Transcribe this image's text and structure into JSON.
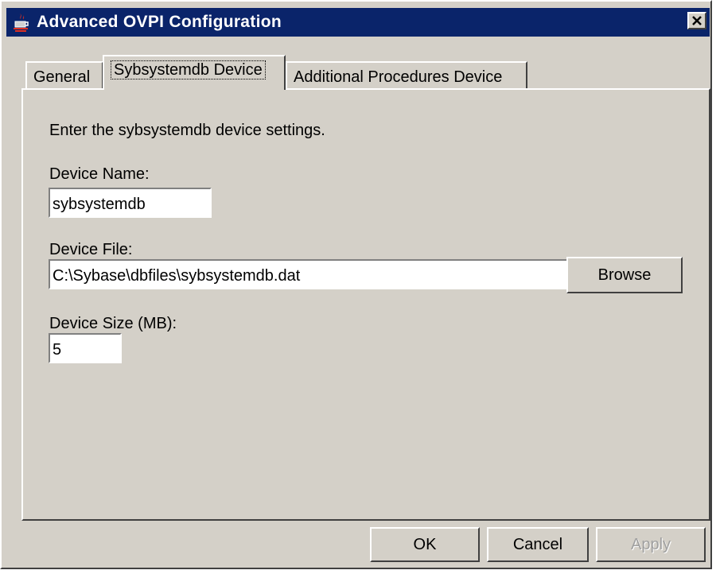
{
  "window": {
    "title": "Advanced OVPI Configuration"
  },
  "tabs": [
    {
      "label": "General",
      "selected": false
    },
    {
      "label": "Sybsystemdb Device",
      "selected": true
    },
    {
      "label": "Additional Procedures Device",
      "selected": false
    }
  ],
  "panel": {
    "instructions": "Enter the sybsystemdb device settings.",
    "device_name": {
      "label": "Device Name:",
      "value": "sybsystemdb"
    },
    "device_file": {
      "label": "Device File:",
      "value": "C:\\Sybase\\dbfiles\\sybsystemdb.dat",
      "browse_label": "Browse"
    },
    "device_size": {
      "label": "Device Size (MB):",
      "value": "5"
    }
  },
  "footer": {
    "ok_label": "OK",
    "cancel_label": "Cancel",
    "apply_label": "Apply"
  },
  "icons": [
    "java-cup-icon",
    "close-icon"
  ],
  "colors": {
    "titlebar": "#0a246a",
    "face": "#d4d0c8"
  }
}
